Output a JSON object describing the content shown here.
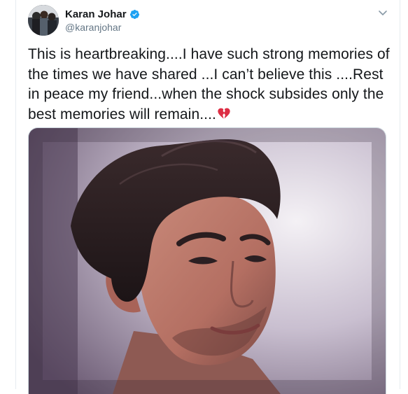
{
  "tweet": {
    "author_name": "Karan Johar",
    "author_handle": "@karanjohar",
    "verified": true,
    "text": "This is heartbreaking....I have such strong memories of the times we have shared ...I can’t believe this ....Rest in peace my friend...when the shock subsides only the best memories will remain....",
    "emoji": "broken-heart-icon"
  },
  "icons": {
    "verified": "verified-badge-icon",
    "menu": "chevron-down-icon"
  },
  "colors": {
    "verified_blue": "#1da1f2",
    "broken_heart_red": "#dd2e44",
    "handle_gray": "#657786"
  }
}
